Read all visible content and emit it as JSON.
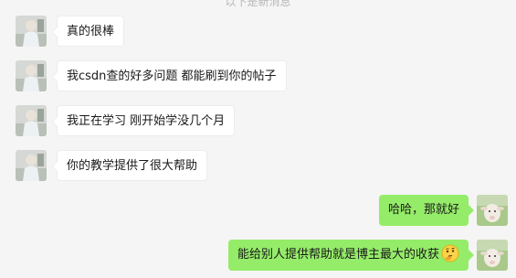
{
  "chat": {
    "top_note": "以下是新消息",
    "messages": [
      {
        "side": "left",
        "text": "真的很棒",
        "avatar_icon": "user-photo-avatar-icon"
      },
      {
        "side": "left",
        "text": "我csdn查的好多问题 都能刷到你的帖子",
        "avatar_icon": "user-photo-avatar-icon"
      },
      {
        "side": "left",
        "text": "我正在学习 刚开始学没几个月",
        "avatar_icon": "user-photo-avatar-icon"
      },
      {
        "side": "left",
        "text": "你的教学提供了很大帮助",
        "avatar_icon": "user-photo-avatar-icon"
      },
      {
        "side": "right",
        "text": "哈哈，那就好",
        "avatar_icon": "sheep-avatar-icon"
      },
      {
        "side": "right",
        "text": "能给别人提供帮助就是博主最大的收获",
        "avatar_icon": "sheep-avatar-icon",
        "emoji": "thinking-face-icon"
      }
    ]
  },
  "colors": {
    "background": "#f5f5f5",
    "left_bubble": "#ffffff",
    "right_bubble": "#95ec69",
    "text": "#191919"
  }
}
